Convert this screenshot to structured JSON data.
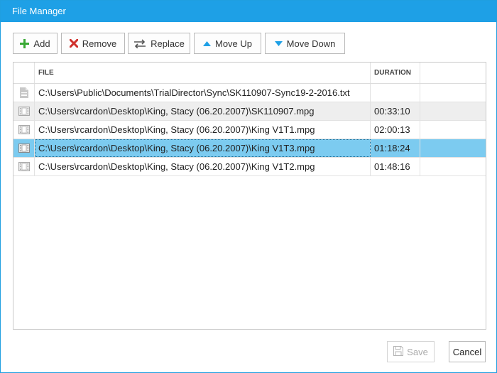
{
  "window": {
    "title": "File Manager"
  },
  "toolbar": {
    "add_label": "Add",
    "remove_label": "Remove",
    "replace_label": "Replace",
    "move_up_label": "Move Up",
    "move_down_label": "Move Down"
  },
  "grid": {
    "columns": {
      "file": "FILE",
      "duration": "DURATION"
    },
    "rows": [
      {
        "icon": "document-icon",
        "file": "C:\\Users\\Public\\Documents\\TrialDirector\\Sync\\SK110907-Sync19-2-2016.txt",
        "duration": ""
      },
      {
        "icon": "film-icon",
        "file": "C:\\Users\\rcardon\\Desktop\\King, Stacy (06.20.2007)\\SK110907.mpg",
        "duration": "00:33:10"
      },
      {
        "icon": "film-icon",
        "file": "C:\\Users\\rcardon\\Desktop\\King, Stacy (06.20.2007)\\King V1T1.mpg",
        "duration": "02:00:13"
      },
      {
        "icon": "film-icon",
        "file": "C:\\Users\\rcardon\\Desktop\\King, Stacy (06.20.2007)\\King V1T3.mpg",
        "duration": "01:18:24"
      },
      {
        "icon": "film-icon",
        "file": "C:\\Users\\rcardon\\Desktop\\King, Stacy (06.20.2007)\\King V1T2.mpg",
        "duration": "01:48:16"
      }
    ]
  },
  "footer": {
    "save_label": "Save",
    "cancel_label": "Cancel"
  },
  "colors": {
    "titlebar": "#1ea0e6",
    "selected_row": "#7ccbf0",
    "alt_row": "#eeeeee",
    "add_icon": "#3aa935",
    "remove_icon": "#d0312d",
    "move_icon": "#1ea0e6"
  }
}
